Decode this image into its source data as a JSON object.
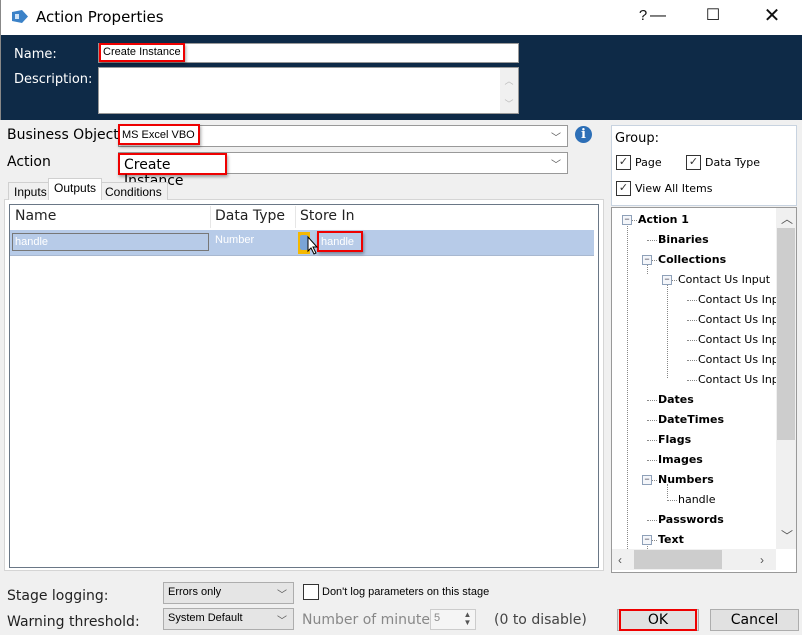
{
  "window": {
    "title": "Action Properties",
    "help_glyph": "?",
    "minimize_glyph": "—",
    "maximize_glyph": "☐",
    "close_glyph": "✕"
  },
  "header": {
    "name_label": "Name:",
    "name_value": "Create Instance",
    "description_label": "Description:",
    "description_value": ""
  },
  "business_object": {
    "label": "Business Object",
    "value": "MS Excel VBO"
  },
  "action": {
    "label": "Action",
    "value": "Create Instance"
  },
  "tabs": [
    {
      "label": "Inputs",
      "active": false
    },
    {
      "label": "Outputs",
      "active": true
    },
    {
      "label": "Conditions",
      "active": false
    }
  ],
  "outputs_grid": {
    "columns": [
      "Name",
      "Data Type",
      "Store In"
    ],
    "rows": [
      {
        "name": "handle",
        "data_type": "Number",
        "store_in": "handle"
      }
    ]
  },
  "group": {
    "label": "Group:",
    "options": [
      {
        "label": "Page",
        "checked": true
      },
      {
        "label": "Data Type",
        "checked": true
      },
      {
        "label": "View All Items",
        "checked": true
      }
    ]
  },
  "tree": {
    "items": [
      {
        "label": "Action 1",
        "bold": true,
        "level": 0,
        "expander": "minus"
      },
      {
        "label": "Binaries",
        "bold": true,
        "level": 1
      },
      {
        "label": "Collections",
        "bold": true,
        "level": 1,
        "expander": "minus"
      },
      {
        "label": "Contact Us Input",
        "bold": false,
        "level": 2,
        "expander": "minus"
      },
      {
        "label": "Contact Us Inp",
        "bold": false,
        "level": 3
      },
      {
        "label": "Contact Us Inp",
        "bold": false,
        "level": 3
      },
      {
        "label": "Contact Us Inp",
        "bold": false,
        "level": 3
      },
      {
        "label": "Contact Us Inp",
        "bold": false,
        "level": 3
      },
      {
        "label": "Contact Us Inp",
        "bold": false,
        "level": 3
      },
      {
        "label": "Dates",
        "bold": true,
        "level": 1
      },
      {
        "label": "DateTimes",
        "bold": true,
        "level": 1
      },
      {
        "label": "Flags",
        "bold": true,
        "level": 1
      },
      {
        "label": "Images",
        "bold": true,
        "level": 1
      },
      {
        "label": "Numbers",
        "bold": true,
        "level": 1,
        "expander": "minus"
      },
      {
        "label": "handle",
        "bold": false,
        "level": 2
      },
      {
        "label": "Passwords",
        "bold": true,
        "level": 1
      },
      {
        "label": "Text",
        "bold": true,
        "level": 1,
        "expander": "minus"
      }
    ]
  },
  "logging": {
    "stage_logging_label": "Stage logging:",
    "stage_logging_value": "Errors only",
    "dont_log_label": "Don't log parameters on this stage",
    "dont_log_checked": false,
    "warning_threshold_label": "Warning threshold:",
    "warning_threshold_value": "System Default",
    "minutes_label": "Number of minutes",
    "minutes_value": "5",
    "disable_hint": "(0 to disable)"
  },
  "buttons": {
    "ok": "OK",
    "cancel": "Cancel"
  },
  "colors": {
    "header_bg": "#0e2a47",
    "highlight": "#e00000",
    "selected_row": "#b7cbe8",
    "info_icon": "#2d6fb7"
  }
}
